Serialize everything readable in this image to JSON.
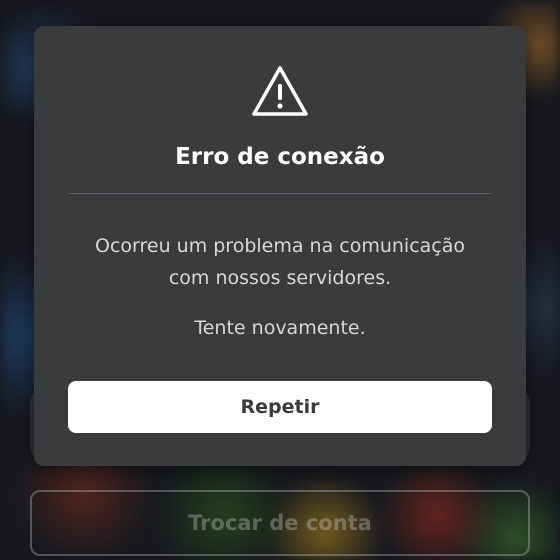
{
  "background": {
    "switch_account_label": "Trocar de conta"
  },
  "dialog": {
    "icon": "warning-triangle-icon",
    "title": "Erro de conexão",
    "message_line1": "Ocorreu um problema na comunicação",
    "message_line2": "com nossos servidores.",
    "hint": "Tente novamente.",
    "retry_label": "Repetir"
  },
  "colors": {
    "dialog_bg": "#393b3d",
    "button_bg": "#ffffff",
    "button_text": "#393b3d",
    "title": "#ffffff",
    "body_text": "#d8d8d8"
  }
}
